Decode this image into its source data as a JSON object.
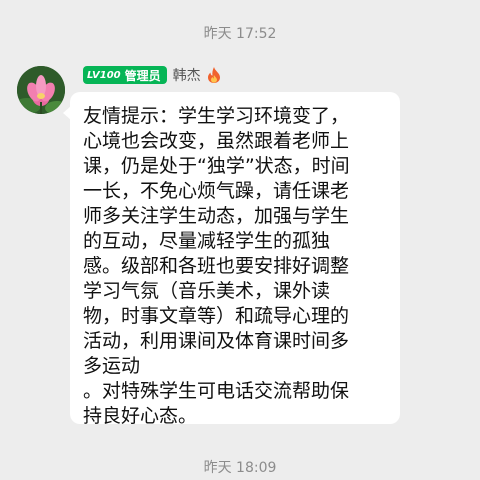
{
  "timestamps": {
    "top": "昨天 17:52",
    "bottom": "昨天 18:09"
  },
  "message": {
    "badge_level": "LV100",
    "badge_role": "管理员",
    "sender_name": "韩杰",
    "sender_icon": "fire-icon",
    "avatar_icon": "lotus-flower",
    "text": "友情提示：学生学习环境变了，\n心境也会改变，虽然跟着老师上\n课，仍是处于“独学”状态，时间\n一长，不免心烦气躁，请任课老\n师多关注学生动态，加强与学生\n的互动，尽量减轻学生的孤独\n感。级部和各班也要安排好调整\n学习气氛（音乐美术，课外读\n物，时事文章等）和疏导心理的\n活动，利用课间及体育课时间多\n多运动\n。对特殊学生可电话交流帮助保\n持良好心态。",
    "badge_color": "#06b556",
    "bubble_color": "#ffffff",
    "background_color": "#ededed"
  }
}
